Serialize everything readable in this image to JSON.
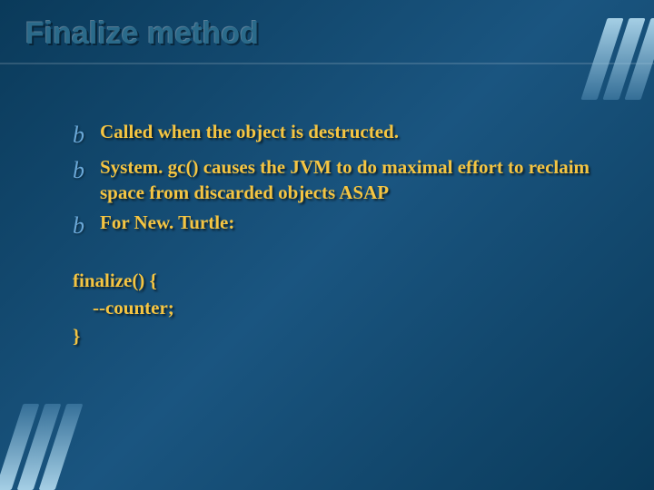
{
  "title": "Finalize method",
  "bullets": [
    {
      "marker": "b",
      "text": "Called when the object is destructed."
    },
    {
      "marker": "b",
      "text": " System. gc() causes the JVM to do maximal effort to reclaim space from discarded objects ASAP"
    },
    {
      "marker": "b",
      "text": "For New. Turtle:"
    }
  ],
  "code": {
    "line1": "finalize() {",
    "line2": "--counter;",
    "line3": "}"
  },
  "colors": {
    "accent": "#f5c542",
    "bullet": "#6aa8d8",
    "bg": "#0a3a5a"
  }
}
